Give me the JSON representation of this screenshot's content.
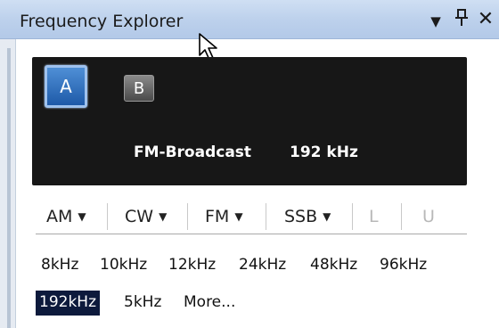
{
  "window": {
    "title": "Frequency Explorer"
  },
  "title_buttons": {
    "menu": "▼",
    "pin": "ᵽ",
    "close": "✕"
  },
  "display": {
    "receiver_a": "A",
    "receiver_b": "B",
    "mode": "FM-Broadcast",
    "bandwidth": "192 kHz"
  },
  "modes": [
    {
      "label": "AM",
      "dropdown": true,
      "enabled": true
    },
    {
      "label": "CW",
      "dropdown": true,
      "enabled": true
    },
    {
      "label": "FM",
      "dropdown": true,
      "enabled": true
    },
    {
      "label": "SSB",
      "dropdown": true,
      "enabled": true
    },
    {
      "label": "L",
      "dropdown": false,
      "enabled": false
    },
    {
      "label": "U",
      "dropdown": false,
      "enabled": false
    }
  ],
  "bandwidths": {
    "row1": [
      "8kHz",
      "10kHz",
      "12kHz",
      "24kHz",
      "48kHz",
      "96kHz"
    ],
    "row2": [
      "192kHz",
      "5kHz",
      "More..."
    ],
    "selected": "192kHz"
  },
  "colors": {
    "titlebar": "#bdd1ec",
    "display_bg": "#171717",
    "accent": "#1e5aa8",
    "selected_bg": "#0d1a3c"
  }
}
